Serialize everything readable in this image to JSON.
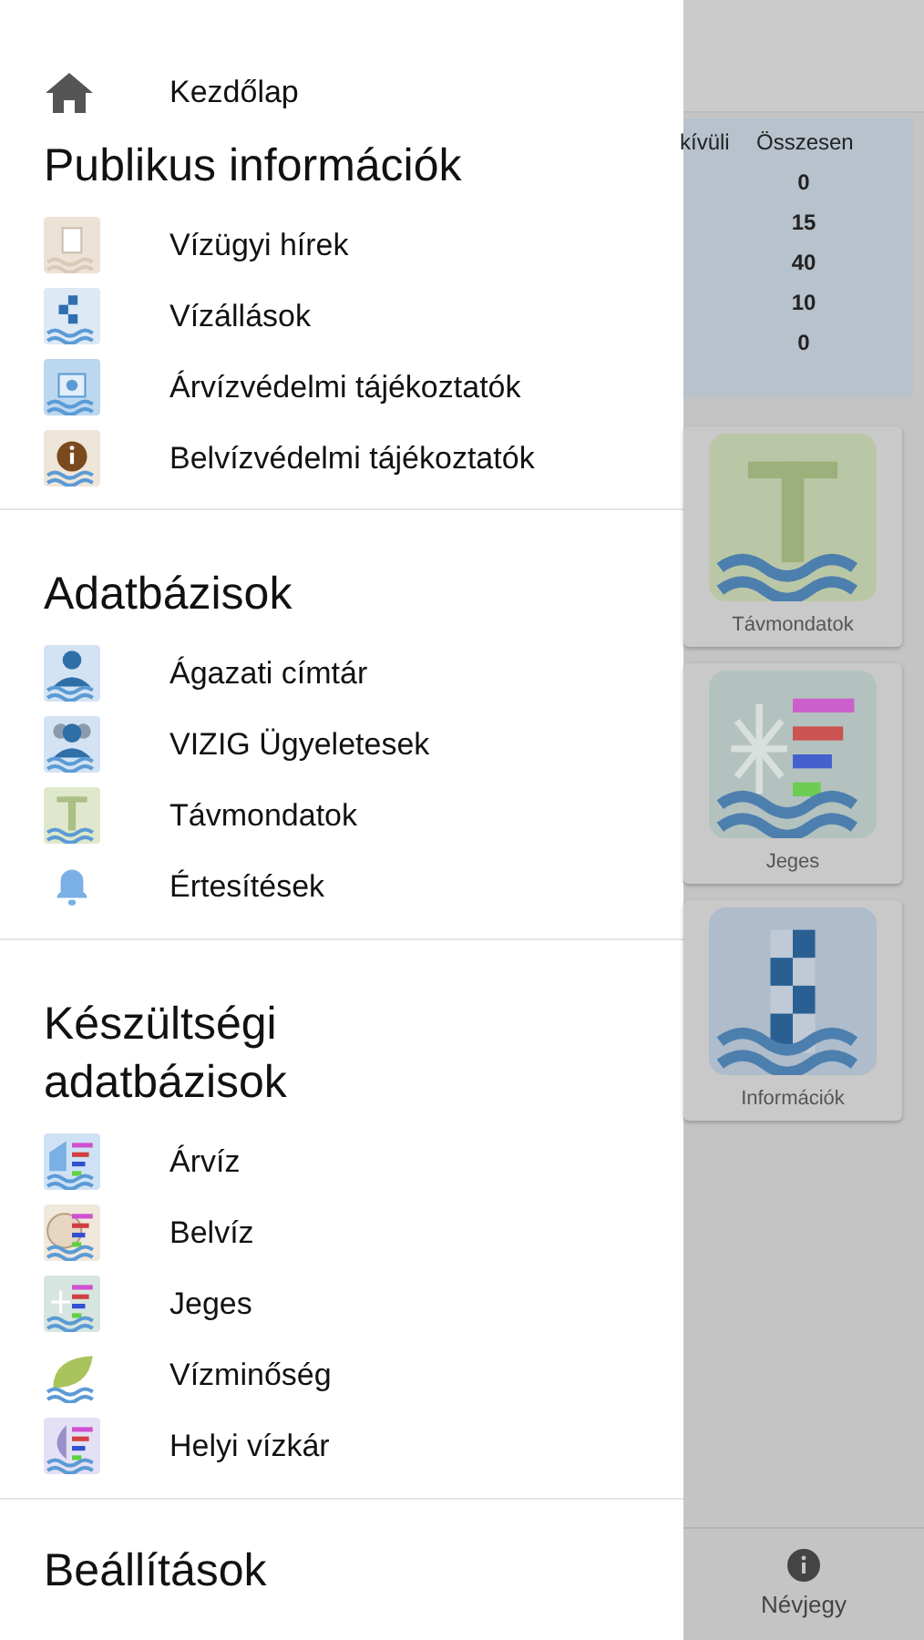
{
  "drawer": {
    "home": {
      "label": "Kezdőlap"
    },
    "sections": [
      {
        "title": "Publikus információk",
        "items": [
          {
            "label": "Vízügyi hírek"
          },
          {
            "label": "Vízállások"
          },
          {
            "label": "Árvízvédelmi tájékoztatók"
          },
          {
            "label": "Belvízvédelmi tájékoztatók"
          }
        ]
      },
      {
        "title": "Adatbázisok",
        "items": [
          {
            "label": "Ágazati címtár"
          },
          {
            "label": "VIZIG Ügyeletesek"
          },
          {
            "label": "Távmondatok"
          },
          {
            "label": "Értesítések"
          }
        ]
      },
      {
        "title": "Készültségi adatbázisok",
        "items": [
          {
            "label": "Árvíz"
          },
          {
            "label": "Belvíz"
          },
          {
            "label": "Jeges"
          },
          {
            "label": "Vízminőség"
          },
          {
            "label": "Helyi vízkár"
          }
        ]
      }
    ],
    "last_section": {
      "title": "Beállítások"
    }
  },
  "background": {
    "table": {
      "columns": [
        "kívüli",
        "Összesen"
      ],
      "rows": [
        "0",
        "15",
        "40",
        "10",
        "0"
      ]
    },
    "tiles": [
      {
        "label": "Távmondatok"
      },
      {
        "label": "Jeges"
      },
      {
        "label": "Információk"
      }
    ],
    "bottom_tab": {
      "label": "Névjegy"
    }
  }
}
